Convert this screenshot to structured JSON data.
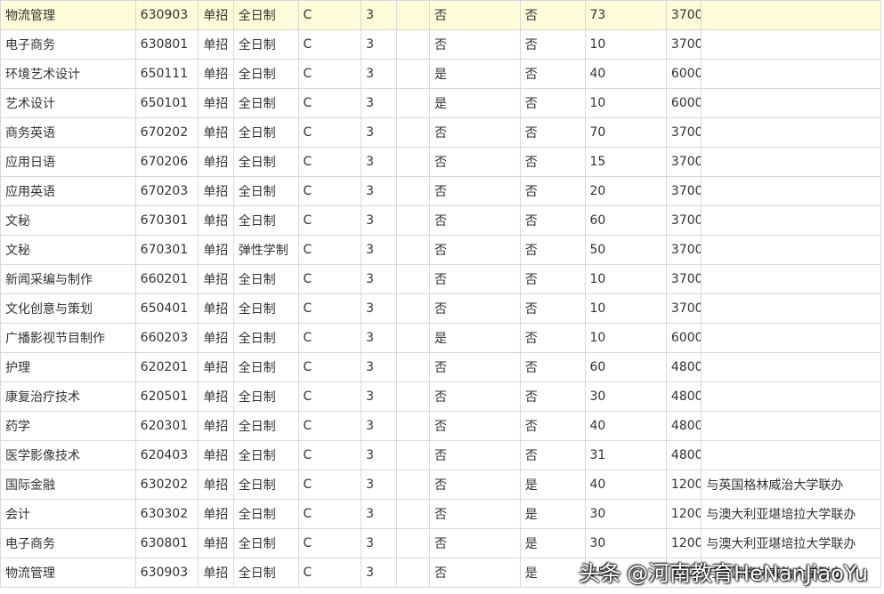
{
  "rows": [
    [
      "物流管理",
      "630903",
      "单招",
      "全日制",
      "C",
      "3",
      "否",
      "否",
      "73",
      "3700",
      ""
    ],
    [
      "电子商务",
      "630801",
      "单招",
      "全日制",
      "C",
      "3",
      "否",
      "否",
      "10",
      "3700",
      ""
    ],
    [
      "环境艺术设计",
      "650111",
      "单招",
      "全日制",
      "C",
      "3",
      "是",
      "否",
      "40",
      "6000",
      ""
    ],
    [
      "艺术设计",
      "650101",
      "单招",
      "全日制",
      "C",
      "3",
      "是",
      "否",
      "10",
      "6000",
      ""
    ],
    [
      "商务英语",
      "670202",
      "单招",
      "全日制",
      "C",
      "3",
      "否",
      "否",
      "70",
      "3700",
      ""
    ],
    [
      "应用日语",
      "670206",
      "单招",
      "全日制",
      "C",
      "3",
      "否",
      "否",
      "15",
      "3700",
      ""
    ],
    [
      "应用英语",
      "670203",
      "单招",
      "全日制",
      "C",
      "3",
      "否",
      "否",
      "20",
      "3700",
      ""
    ],
    [
      "文秘",
      "670301",
      "单招",
      "全日制",
      "C",
      "3",
      "否",
      "否",
      "60",
      "3700",
      ""
    ],
    [
      "文秘",
      "670301",
      "单招",
      "弹性学制",
      "C",
      "3",
      "否",
      "否",
      "50",
      "3700",
      ""
    ],
    [
      "新闻采编与制作",
      "660201",
      "单招",
      "全日制",
      "C",
      "3",
      "否",
      "否",
      "10",
      "3700",
      ""
    ],
    [
      "文化创意与策划",
      "650401",
      "单招",
      "全日制",
      "C",
      "3",
      "否",
      "否",
      "10",
      "3700",
      ""
    ],
    [
      "广播影视节目制作",
      "660203",
      "单招",
      "全日制",
      "C",
      "3",
      "是",
      "否",
      "10",
      "6000",
      ""
    ],
    [
      "护理",
      "620201",
      "单招",
      "全日制",
      "C",
      "3",
      "否",
      "否",
      "60",
      "4800",
      ""
    ],
    [
      "康复治疗技术",
      "620501",
      "单招",
      "全日制",
      "C",
      "3",
      "否",
      "否",
      "30",
      "4800",
      ""
    ],
    [
      "药学",
      "620301",
      "单招",
      "全日制",
      "C",
      "3",
      "否",
      "否",
      "40",
      "4800",
      ""
    ],
    [
      "医学影像技术",
      "620403",
      "单招",
      "全日制",
      "C",
      "3",
      "否",
      "否",
      "31",
      "4800",
      ""
    ],
    [
      "国际金融",
      "630202",
      "单招",
      "全日制",
      "C",
      "3",
      "否",
      "是",
      "40",
      "12000",
      "与英国格林威治大学联办"
    ],
    [
      "会计",
      "630302",
      "单招",
      "全日制",
      "C",
      "3",
      "否",
      "是",
      "30",
      "12000",
      "与澳大利亚堪培拉大学联办"
    ],
    [
      "电子商务",
      "630801",
      "单招",
      "全日制",
      "C",
      "3",
      "否",
      "是",
      "30",
      "12000",
      "与澳大利亚堪培拉大学联办"
    ],
    [
      "物流管理",
      "630903",
      "单招",
      "全日制",
      "C",
      "3",
      "否",
      "是",
      "75",
      "12000",
      "与英国格林威治大学联办"
    ]
  ],
  "watermark": {
    "source": "头条",
    "account": "@河南教育HeNanJiaoYu"
  }
}
